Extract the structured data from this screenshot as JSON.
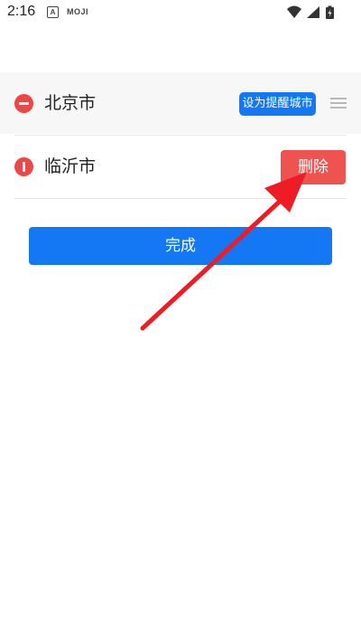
{
  "status_bar": {
    "time": "2:16",
    "notif_badge": "A",
    "notif_app": "MOJI",
    "icons": [
      "wifi-icon",
      "signal-icon",
      "battery-charging-icon"
    ]
  },
  "cities": [
    {
      "name": "北京市",
      "action_label": "设为提醒城市",
      "state": "normal"
    },
    {
      "name": "临沂市",
      "delete_label": "删除",
      "state": "delete-revealed"
    }
  ],
  "done_label": "完成",
  "colors": {
    "accent": "#1478f5",
    "remove": "#e84848",
    "delete": "#ef5350",
    "arrow": "#ee1c24"
  }
}
